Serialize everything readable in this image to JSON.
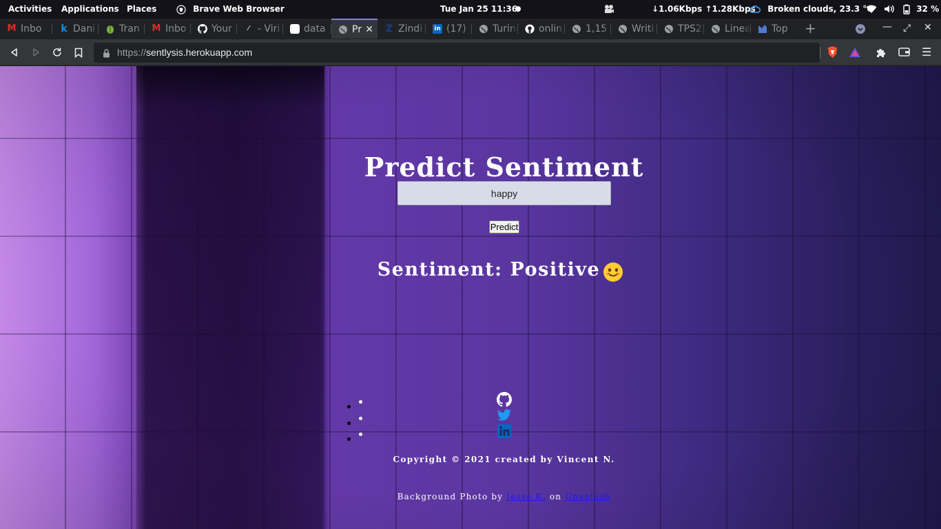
{
  "system_bar": {
    "activities": "Activities",
    "applications": "Applications",
    "places": "Places",
    "active_app": "Brave Web Browser",
    "datetime": "Tue Jan 25  11:36",
    "network_speed": "↓1.06Kbps ↑1.28Kbps",
    "weather": "Broken clouds, 23.3 °C",
    "battery": "32 %"
  },
  "tabs": [
    {
      "label": "Inbo",
      "icon": "gmail-icon",
      "color": "#d93025"
    },
    {
      "label": "Dani",
      "icon": "k-icon",
      "color": "#1a8fd0"
    },
    {
      "label": "Tran",
      "icon": "leaf-icon",
      "color": "#7cb342"
    },
    {
      "label": "Inbo",
      "icon": "gmail-icon",
      "color": "#d93025"
    },
    {
      "label": "Your",
      "icon": "github-icon",
      "color": "#ffffff"
    },
    {
      "label": "- Viri",
      "icon": "generic-icon",
      "color": "#cccccc"
    },
    {
      "label": "data",
      "icon": "box-icon",
      "color": "#ffffff"
    },
    {
      "label": "Pr",
      "icon": "globe-icon",
      "color": "#9aa0a6",
      "active": true
    },
    {
      "label": "Zindi",
      "icon": "zindi-icon",
      "color": "#1d3a8f"
    },
    {
      "label": "(17)",
      "icon": "linkedin-icon",
      "color": "#0a66c2"
    },
    {
      "label": "Turin",
      "icon": "globe-icon",
      "color": "#9aa0a6"
    },
    {
      "label": "onlin",
      "icon": "github-icon",
      "color": "#ffffff"
    },
    {
      "label": "1,15",
      "icon": "globe-icon",
      "color": "#9aa0a6"
    },
    {
      "label": "Writi",
      "icon": "globe-icon",
      "color": "#9aa0a6"
    },
    {
      "label": "TPS2",
      "icon": "globe-icon",
      "color": "#9aa0a6"
    },
    {
      "label": "Linea",
      "icon": "globe-icon",
      "color": "#9aa0a6"
    },
    {
      "label": "Top",
      "icon": "bookmark-icon",
      "color": "#4f7ad0"
    }
  ],
  "address_bar": {
    "scheme": "https://",
    "host": "sentlysis.herokuapp.com"
  },
  "page": {
    "title": "Predict Sentiment",
    "input_value": "happy",
    "predict_label": "Predict",
    "result_text": "Sentiment: Positive",
    "result_emoji": "smiling-face-icon",
    "social_links": [
      "github-icon",
      "twitter-icon",
      "linkedin-icon"
    ],
    "copyright": "Copyright © 2021 created by Vincent N.",
    "credit_prefix": "Background Photo by",
    "credit_author": "Jesse K.",
    "credit_on": "on",
    "credit_site": "Unsplash"
  },
  "colors": {
    "accent_tab": "#8a80d8",
    "link": "#1a1aee",
    "twitter": "#1d9bf0",
    "linkedin": "#0a66c2"
  }
}
